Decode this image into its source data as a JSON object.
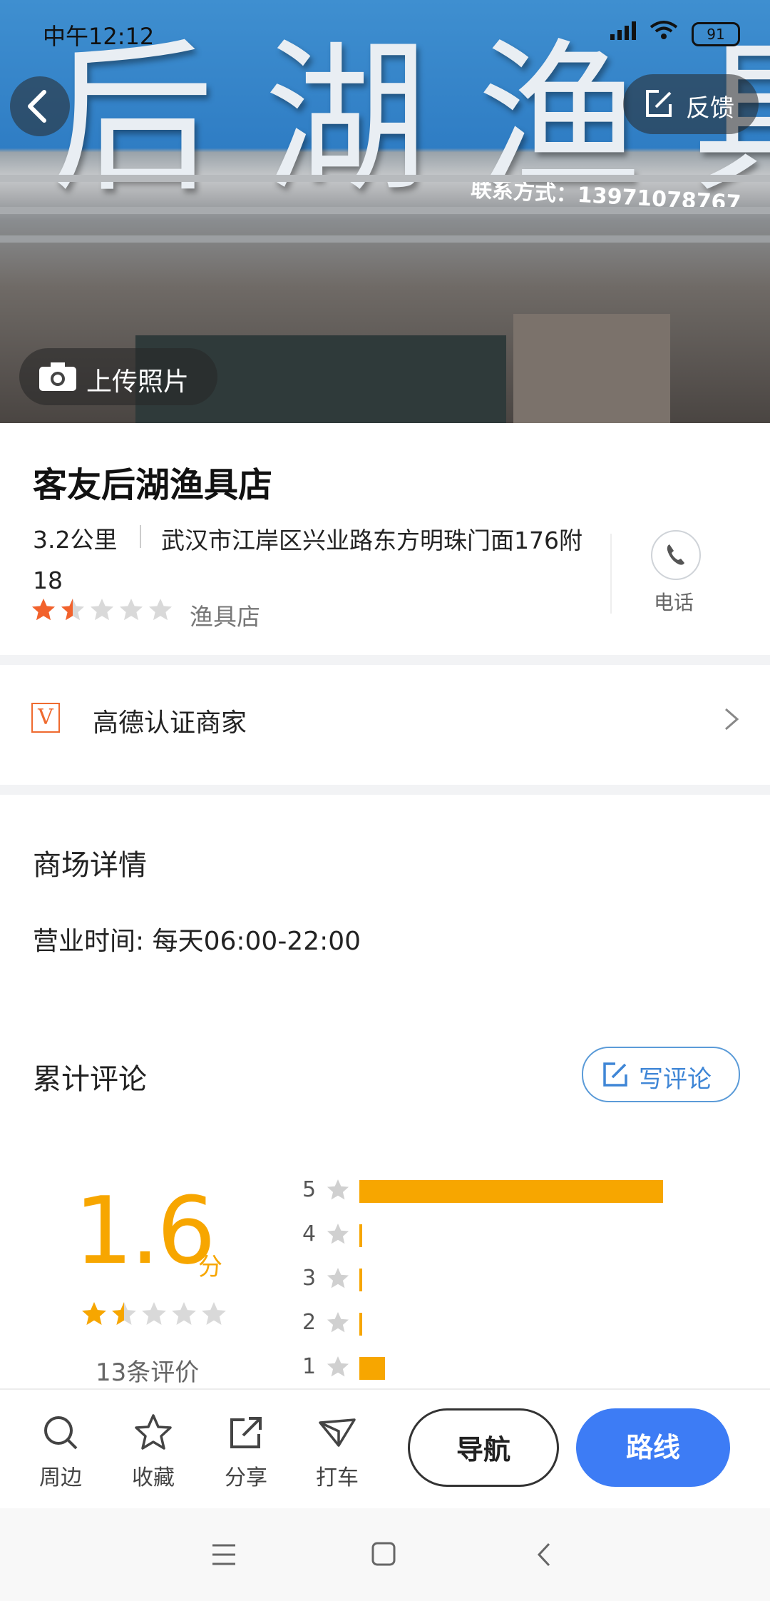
{
  "status_bar": {
    "time": "中午12:12",
    "battery": "91"
  },
  "hero": {
    "sign_text": "后湖渔具",
    "contact_text": "联系方式：13971078767",
    "feedback_label": "反馈",
    "upload_label": "上传照片"
  },
  "poi": {
    "name": "客友后湖渔具店",
    "distance": "3.2公里",
    "address": "武汉市江岸区兴业路东方明珠门面176附18",
    "rating_stars": 1.5,
    "category": "渔具店",
    "phone_label": "电话"
  },
  "verified": {
    "label": "高德认证商家",
    "badge": "V"
  },
  "details": {
    "title": "商场详情",
    "hours": "营业时间: 每天06:00-22:00"
  },
  "reviews": {
    "title": "累计评论",
    "write_label": "写评论",
    "score": "1.6",
    "score_unit": "分",
    "count_text": "13条评价",
    "distribution": [
      {
        "stars": "5",
        "fraction": 0.49
      },
      {
        "stars": "4",
        "fraction": 0.0
      },
      {
        "stars": "3",
        "fraction": 0.0
      },
      {
        "stars": "2",
        "fraction": 0.0
      },
      {
        "stars": "1",
        "fraction": 0.04
      }
    ]
  },
  "bottom_bar": {
    "items": [
      {
        "label": "周边",
        "icon": "search-icon"
      },
      {
        "label": "收藏",
        "icon": "star-icon"
      },
      {
        "label": "分享",
        "icon": "share-icon"
      },
      {
        "label": "打车",
        "icon": "taxi-icon"
      }
    ],
    "nav_label": "导航",
    "route_label": "路线"
  },
  "colors": {
    "accent_blue": "#3d7cf5",
    "rating_orange": "#f7a600",
    "star_red": "#f2622c"
  }
}
